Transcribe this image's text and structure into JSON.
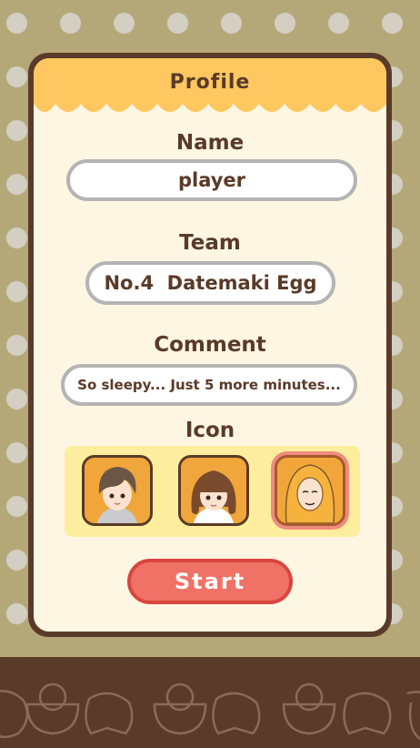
{
  "profile": {
    "title": "Profile",
    "name_label": "Name",
    "name_value": "player",
    "team_label": "Team",
    "team_value": "No.4  Datemaki Egg",
    "comment_label": "Comment",
    "comment_value": "So sleepy... Just 5 more minutes...",
    "icon_label": "Icon",
    "icons": [
      {
        "name": "boy-avatar-icon",
        "selected": false
      },
      {
        "name": "girl-avatar-icon",
        "selected": false
      },
      {
        "name": "egg-hood-avatar-icon",
        "selected": true
      }
    ]
  },
  "start_label": "Start",
  "colors": {
    "background": "#b5a878",
    "card_border": "#5a3a28",
    "card_fill": "#fdf6e3",
    "header": "#ffc75f",
    "start_button": "#f07266",
    "icons_panel": "#fcee9e"
  }
}
